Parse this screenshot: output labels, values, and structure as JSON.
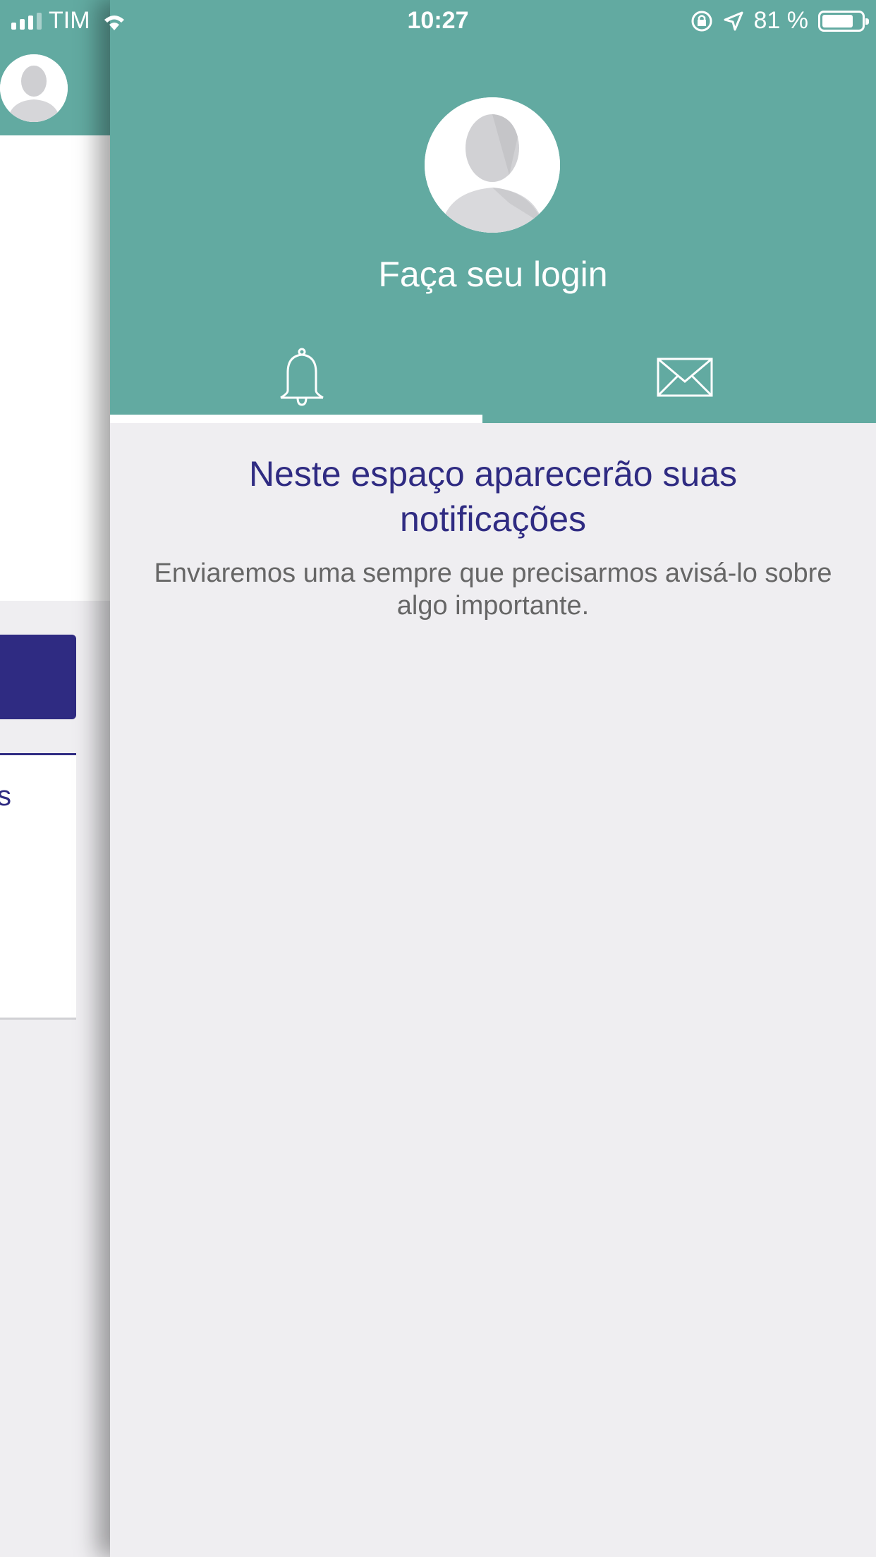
{
  "status_bar": {
    "carrier": "TIM",
    "time": "10:27",
    "battery_text": "81 %",
    "battery_level_percent": 81
  },
  "background_app": {
    "card_text_fragment": "s"
  },
  "drawer": {
    "login_label": "Faça seu login",
    "tabs": [
      {
        "name": "notifications",
        "icon": "bell-icon",
        "selected": true
      },
      {
        "name": "messages",
        "icon": "envelope-icon",
        "selected": false
      }
    ],
    "empty_state": {
      "title": "Neste espaço aparecerão suas notificações",
      "subtitle": "Enviaremos uma sempre que precisarmos avisá-lo sobre algo importante."
    }
  },
  "colors": {
    "header_teal": "#62aaa1",
    "brand_blue": "#2f2b82",
    "background": "#efeef1"
  }
}
